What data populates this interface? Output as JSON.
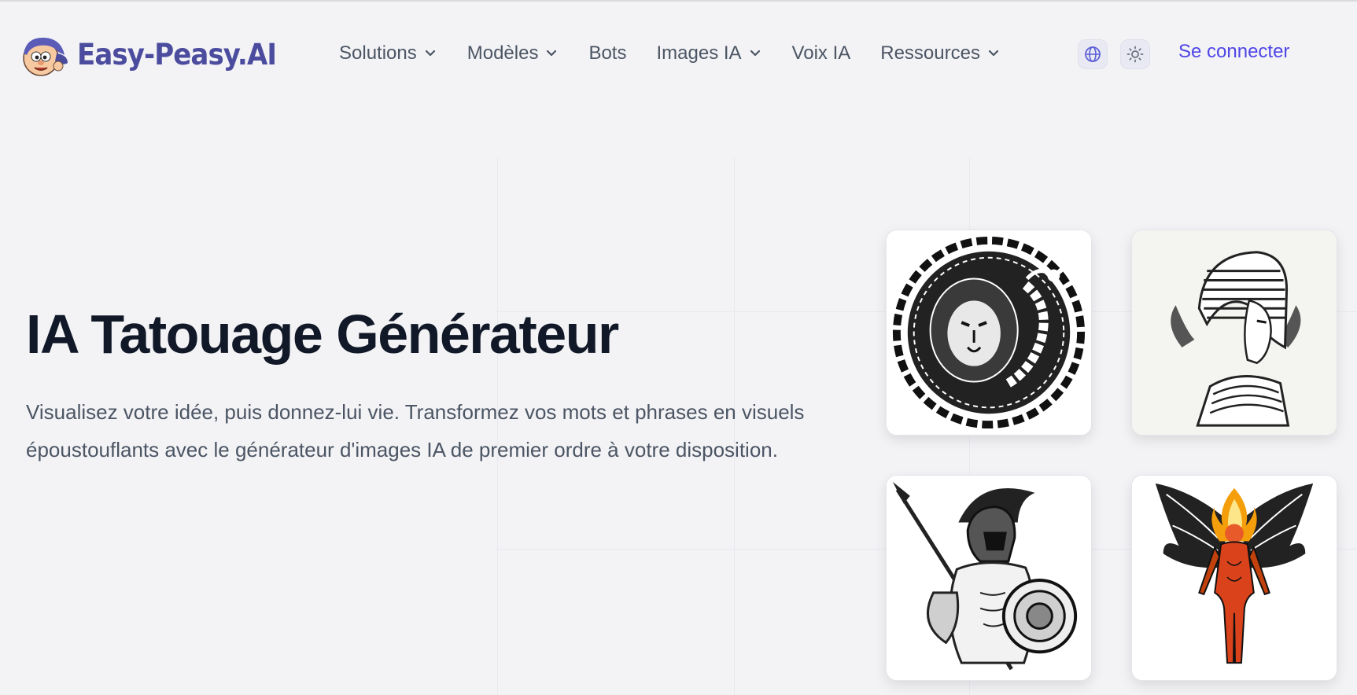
{
  "brand": {
    "name": "Easy-Peasy.AI",
    "color": "#4b4c9e"
  },
  "nav": {
    "items": [
      {
        "label": "Solutions",
        "has_dropdown": true
      },
      {
        "label": "Modèles",
        "has_dropdown": true
      },
      {
        "label": "Bots",
        "has_dropdown": false
      },
      {
        "label": "Images IA",
        "has_dropdown": true
      },
      {
        "label": "Voix IA",
        "has_dropdown": false
      },
      {
        "label": "Ressources",
        "has_dropdown": true
      }
    ],
    "language_icon": "globe-icon",
    "theme_icon": "sun-icon",
    "login_label": "Se connecter",
    "accent": "#4f46e5"
  },
  "hero": {
    "title": "IA Tatouage Générateur",
    "description": "Visualisez votre idée, puis donnez-lui vie. Transformez vos mots et phrases en visuels époustouflants avec le générateur d'images IA de premier ordre à votre disposition."
  },
  "gallery": [
    {
      "subject": "lion-scorpion-tattoo"
    },
    {
      "subject": "egyptian-queen-tattoo"
    },
    {
      "subject": "spartan-warrior-tattoo"
    },
    {
      "subject": "winged-flame-figure-tattoo"
    }
  ]
}
